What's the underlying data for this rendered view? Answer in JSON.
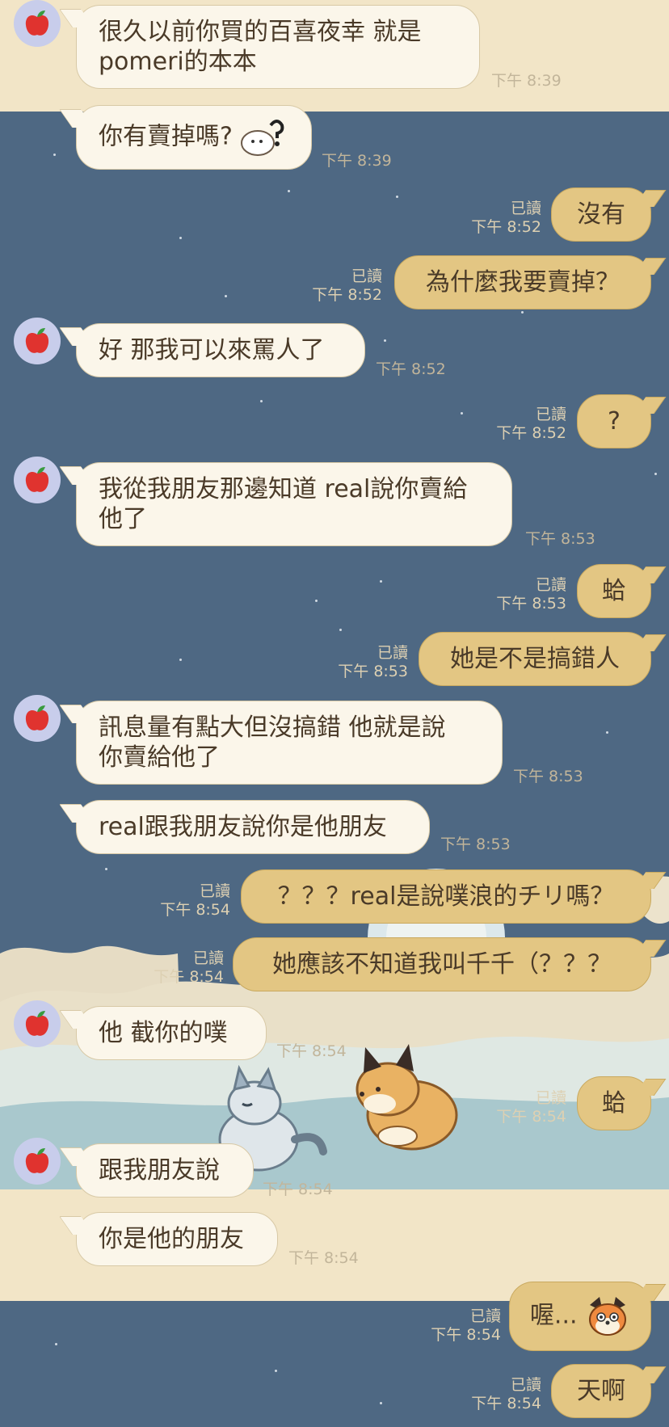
{
  "colors": {
    "cream_bg": "#f2e5c7",
    "night_bg": "#4e6883",
    "incoming_bubble": "#fbf6ea",
    "outgoing_bubble": "#e3c683",
    "text": "#4a3a28",
    "timestamp": "#c2b59a"
  },
  "contact": {
    "avatar_icon": "apple-icon"
  },
  "messages": [
    {
      "dir": "in",
      "text": "很久以前你買的百喜夜幸  就是",
      "text2": "pomeri的本本",
      "time": "下午 8:39"
    },
    {
      "dir": "in",
      "text": "你有賣掉嗎?",
      "sticker": "question-cat-sticker",
      "time": "下午 8:39"
    },
    {
      "dir": "out",
      "text": "沒有",
      "read": "已讀",
      "time": "下午 8:52"
    },
    {
      "dir": "out",
      "text": "為什麼我要賣掉？",
      "read": "已讀",
      "time": "下午 8:52"
    },
    {
      "dir": "in",
      "text": "好 那我可以來罵人了",
      "time": "下午 8:52"
    },
    {
      "dir": "out",
      "text": "?",
      "read": "已讀",
      "time": "下午 8:52"
    },
    {
      "dir": "in",
      "text": "我從我朋友那邊知道 real說你賣給",
      "text2": "他了",
      "time": "下午 8:53"
    },
    {
      "dir": "out",
      "text": "蛤",
      "read": "已讀",
      "time": "下午 8:53"
    },
    {
      "dir": "out",
      "text": "她是不是搞錯人",
      "read": "已讀",
      "time": "下午 8:53"
    },
    {
      "dir": "in",
      "text": "訊息量有點大但沒搞錯  他就是說",
      "text2": "你賣給他了",
      "time": "下午 8:53"
    },
    {
      "dir": "in",
      "text": "real跟我朋友說你是他朋友",
      "time": "下午 8:53"
    },
    {
      "dir": "out",
      "text": "？？？real是說噗浪的チリ嗎？",
      "read": "已讀",
      "time": "下午 8:54"
    },
    {
      "dir": "out",
      "text": "她應該不知道我叫千千（？？？",
      "read": "已讀",
      "time": "下午 8:54"
    },
    {
      "dir": "in",
      "text": "他  截你的噗",
      "time": "下午 8:54"
    },
    {
      "dir": "out",
      "text": "蛤",
      "read": "已讀",
      "time": "下午 8:54"
    },
    {
      "dir": "in",
      "text": "跟我朋友說",
      "time": "下午 8:54"
    },
    {
      "dir": "in",
      "text": "你是他的朋友",
      "time": "下午 8:54"
    },
    {
      "dir": "out",
      "text": "喔...",
      "sticker": "fox-sticker",
      "read": "已讀",
      "time": "下午 8:54"
    },
    {
      "dir": "out",
      "text": "天啊",
      "read": "已讀",
      "time": "下午 8:54"
    }
  ]
}
